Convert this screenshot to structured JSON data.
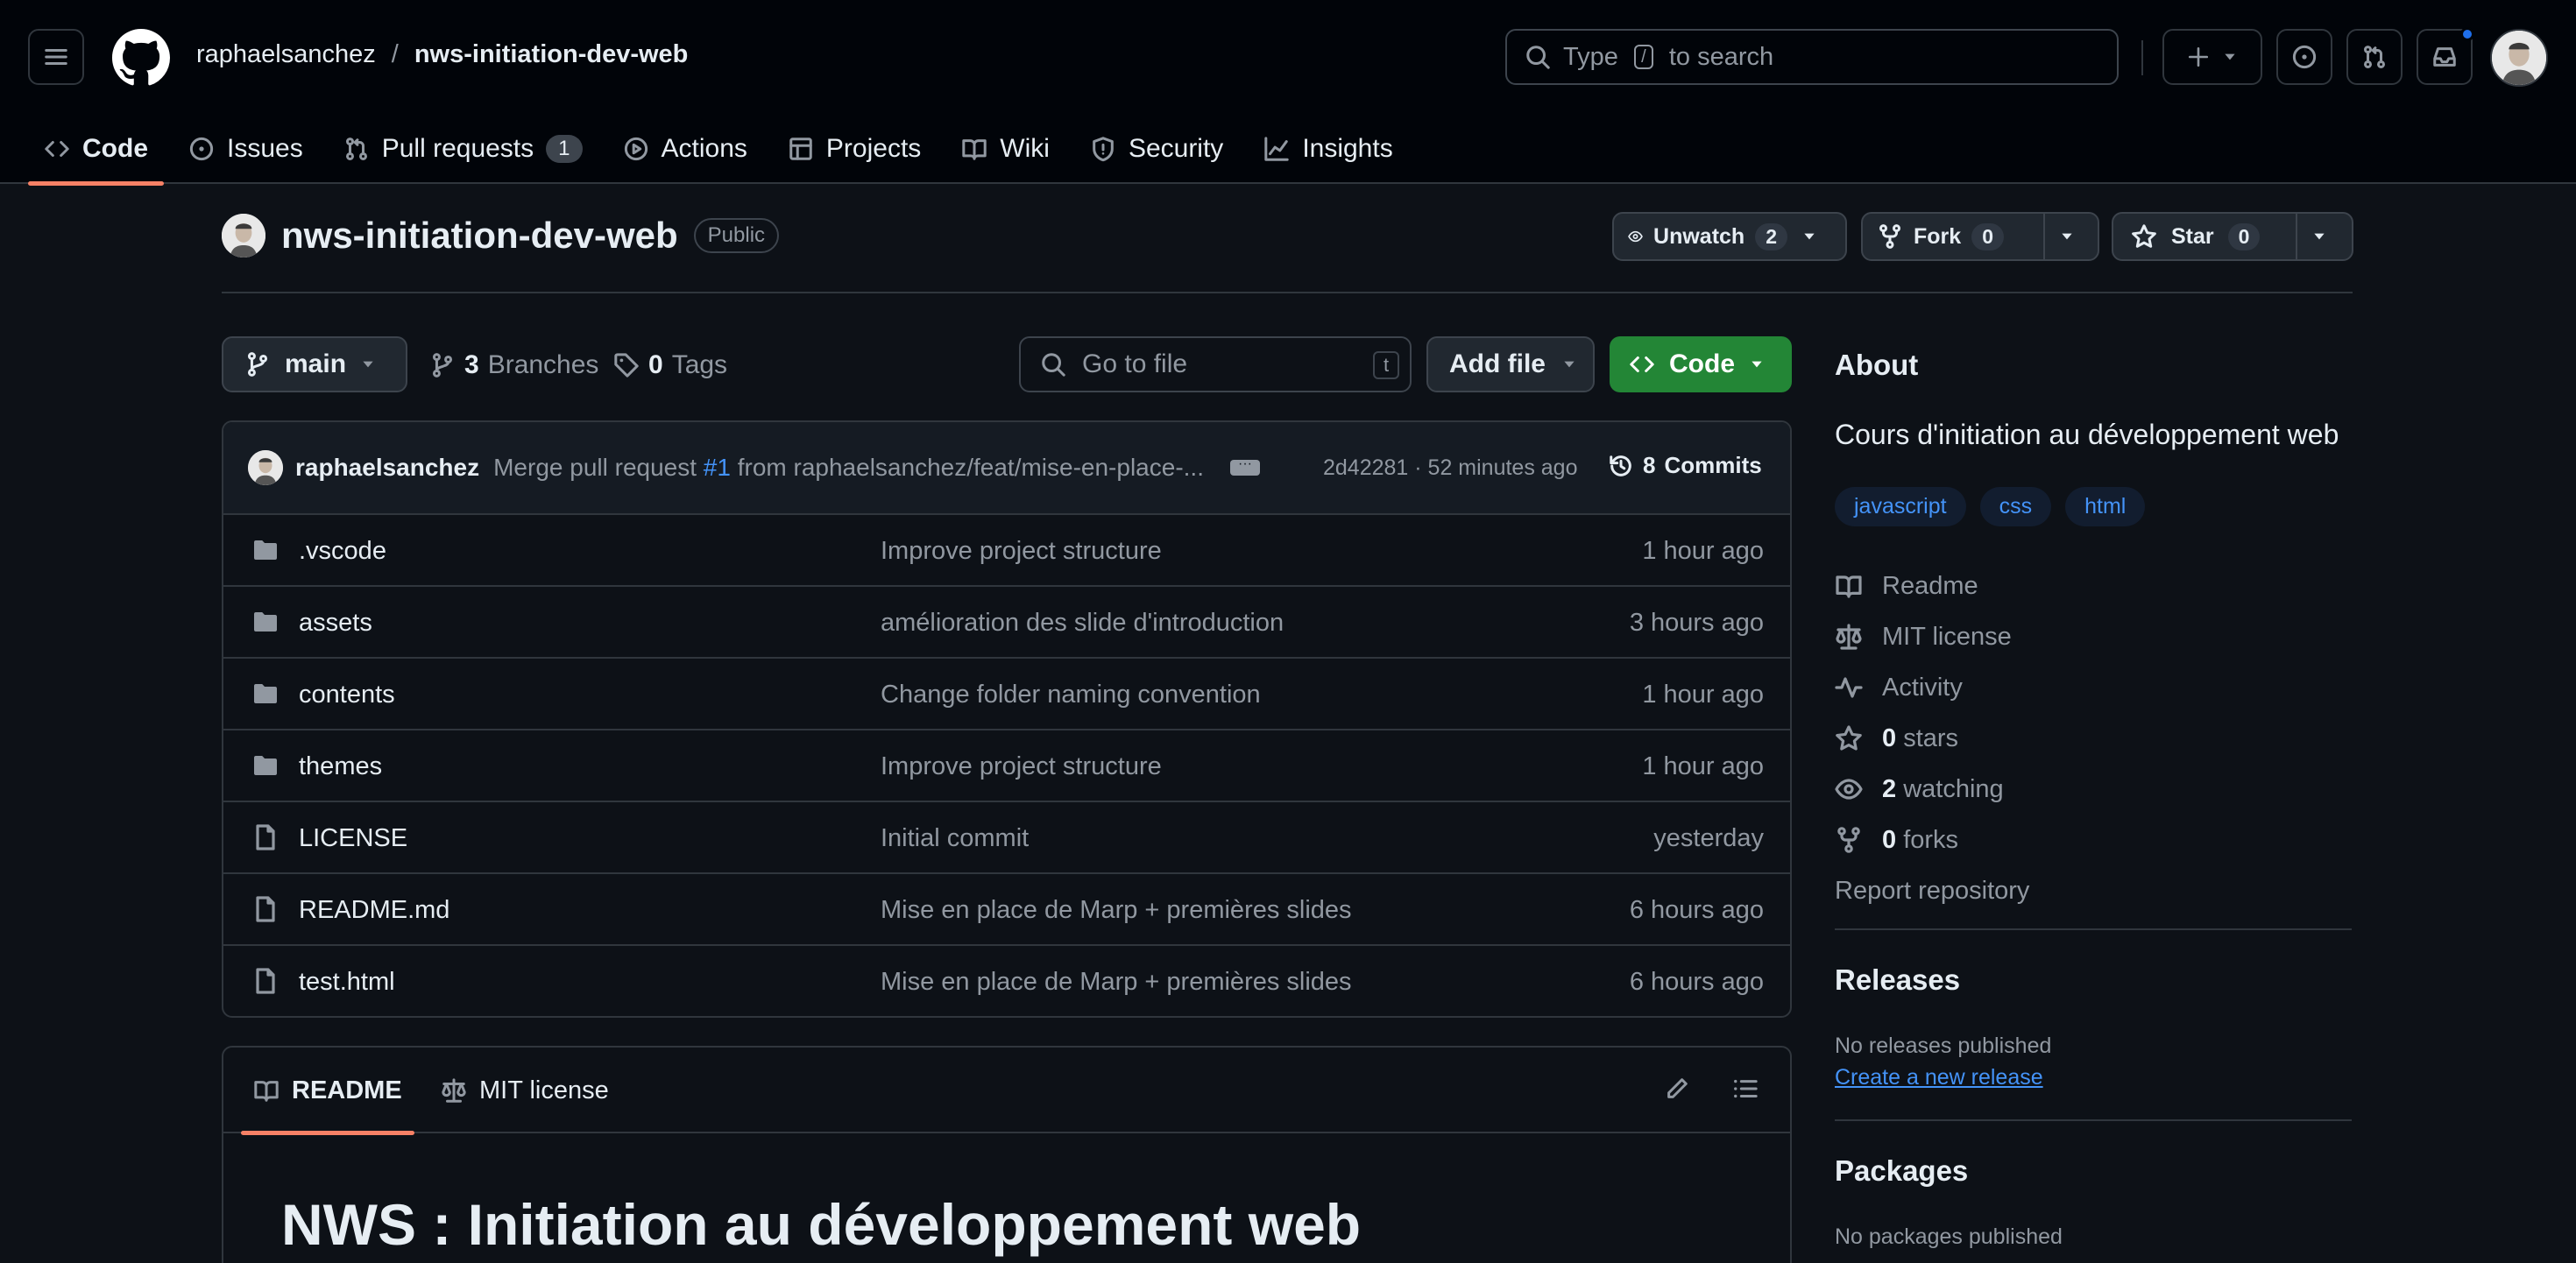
{
  "header": {
    "owner": "raphaelsanchez",
    "separator": "/",
    "repo": "nws-initiation-dev-web",
    "search_pre": "Type",
    "search_key": "/",
    "search_post": "to search"
  },
  "nav": {
    "code": "Code",
    "issues": "Issues",
    "pulls": "Pull requests",
    "pulls_count": "1",
    "actions": "Actions",
    "projects": "Projects",
    "wiki": "Wiki",
    "security": "Security",
    "insights": "Insights"
  },
  "repo": {
    "name": "nws-initiation-dev-web",
    "visibility": "Public",
    "unwatch_label": "Unwatch",
    "watch_count": "2",
    "fork_label": "Fork",
    "fork_count": "0",
    "star_label": "Star",
    "star_count": "0"
  },
  "toolbar": {
    "branch": "main",
    "branches_count": "3",
    "branches_label": "Branches",
    "tags_count": "0",
    "tags_label": "Tags",
    "goto_placeholder": "Go to file",
    "goto_key": "t",
    "add_file": "Add file",
    "code": "Code"
  },
  "commit": {
    "author": "raphaelsanchez",
    "msg_pre": "Merge pull request",
    "pr": "#1",
    "msg_post": "from raphaelsanchez/feat/mise-en-place-...",
    "sha_time": "2d42281 · 52 minutes ago",
    "commits_count": "8",
    "commits_label": "Commits"
  },
  "files": [
    {
      "type": "folder",
      "name": ".vscode",
      "message": "Improve project structure",
      "time": "1 hour ago"
    },
    {
      "type": "folder",
      "name": "assets",
      "message": "amélioration des slide d'introduction",
      "time": "3 hours ago"
    },
    {
      "type": "folder",
      "name": "contents",
      "message": "Change folder naming convention",
      "time": "1 hour ago"
    },
    {
      "type": "folder",
      "name": "themes",
      "message": "Improve project structure",
      "time": "1 hour ago"
    },
    {
      "type": "file",
      "name": "LICENSE",
      "message": "Initial commit",
      "time": "yesterday"
    },
    {
      "type": "file",
      "name": "README.md",
      "message": "Mise en place de Marp + premières slides",
      "time": "6 hours ago"
    },
    {
      "type": "file",
      "name": "test.html",
      "message": "Mise en place de Marp + premières slides",
      "time": "6 hours ago"
    }
  ],
  "readme": {
    "tab_readme": "README",
    "tab_license": "MIT license",
    "heading": "NWS : Initiation au développement web"
  },
  "about": {
    "title": "About",
    "description": "Cours d'initiation au développement web",
    "topics": [
      "javascript",
      "css",
      "html"
    ],
    "readme": "Readme",
    "license": "MIT license",
    "activity": "Activity",
    "stars_count": "0",
    "stars_label": "stars",
    "watching_count": "2",
    "watching_label": "watching",
    "forks_count": "0",
    "forks_label": "forks",
    "report": "Report repository"
  },
  "releases": {
    "title": "Releases",
    "none": "No releases published",
    "create": "Create a new release"
  },
  "packages": {
    "title": "Packages",
    "none": "No packages published"
  }
}
